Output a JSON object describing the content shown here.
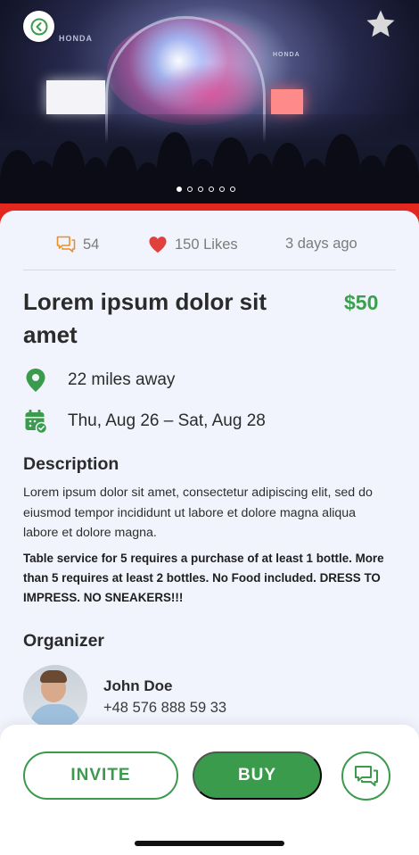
{
  "hero": {
    "sponsor_left": "HONDA",
    "sponsor_right": "HONDA",
    "slide_count": 6,
    "active_slide": 1
  },
  "stats": {
    "comments": "54",
    "likes": "150 Likes",
    "posted": "3 days ago"
  },
  "event": {
    "title": "Lorem ipsum dolor sit amet",
    "price": "$50",
    "distance": "22 miles away",
    "dates": "Thu, Aug 26 – Sat, Aug 28"
  },
  "description": {
    "heading": "Description",
    "body": "Lorem ipsum dolor sit amet, consectetur adipiscing elit, sed do eiusmod tempor incididunt ut labore et dolore magna aliqua labore et dolore magna.",
    "rules": "Table service for 5 requires a purchase of at least 1 bottle. More than 5 requires at least 2 bottles. No Food included. DRESS TO IMPRESS. NO SNEAKERS!!!"
  },
  "organizer": {
    "heading": "Organizer",
    "name": "John Doe",
    "phone": "+48 576 888 59 33"
  },
  "actions": {
    "invite_label": "INVITE",
    "buy_label": "BUY"
  },
  "colors": {
    "accent_green": "#3a9b4c",
    "accent_red": "#e2281e",
    "comment_orange": "#e8902a",
    "card_bg": "#f2f4fd"
  },
  "icons": {
    "back": "chevron-left-icon",
    "favorite": "star-icon",
    "comments": "comment-icon",
    "likes": "heart-icon",
    "location": "map-pin-icon",
    "calendar": "calendar-check-icon",
    "chat": "chat-icon"
  }
}
